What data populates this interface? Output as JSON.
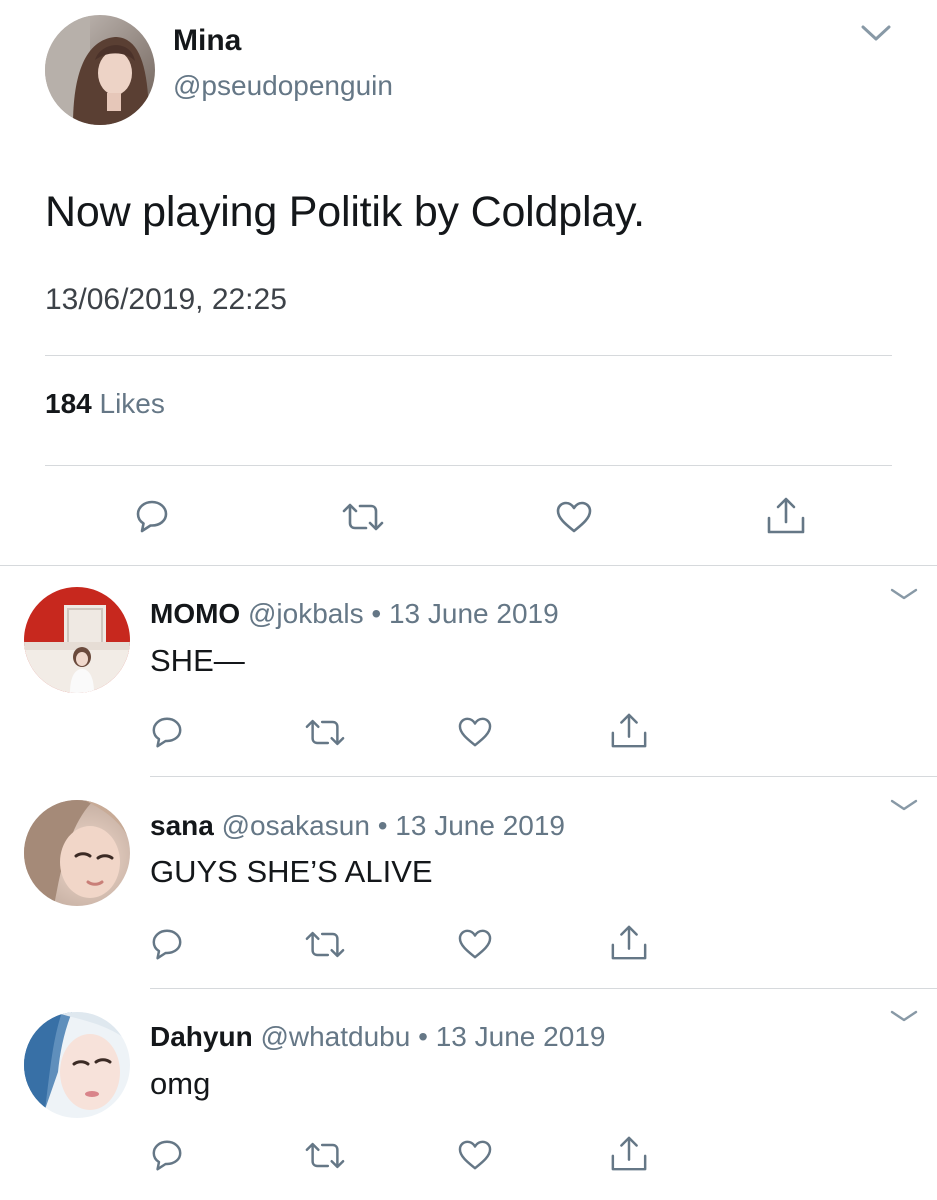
{
  "main_tweet": {
    "name": "Mina",
    "handle": "@pseudopenguin",
    "text": "Now playing Politik by Coldplay.",
    "timestamp": "13/06/2019, 22:25",
    "likes_count": "184",
    "likes_label": "Likes"
  },
  "replies": [
    {
      "name": "MOMO",
      "handle": "@jokbals",
      "sep": "•",
      "date": "13 June 2019",
      "text": "SHE—"
    },
    {
      "name": "sana",
      "handle": "@osakasun",
      "sep": "•",
      "date": "13 June 2019",
      "text": "GUYS SHE’S ALIVE"
    },
    {
      "name": "Dahyun",
      "handle": "@whatdubu",
      "sep": "•",
      "date": "13 June 2019",
      "text": "omg"
    }
  ],
  "icons": {
    "reply": "reply-icon",
    "retweet": "retweet-icon",
    "like": "like-icon",
    "share": "share-icon",
    "more": "chevron-down-icon"
  },
  "colors": {
    "text": "#14171a",
    "secondary": "#657786",
    "icon": "#657786",
    "divider": "#d6d9dc"
  }
}
